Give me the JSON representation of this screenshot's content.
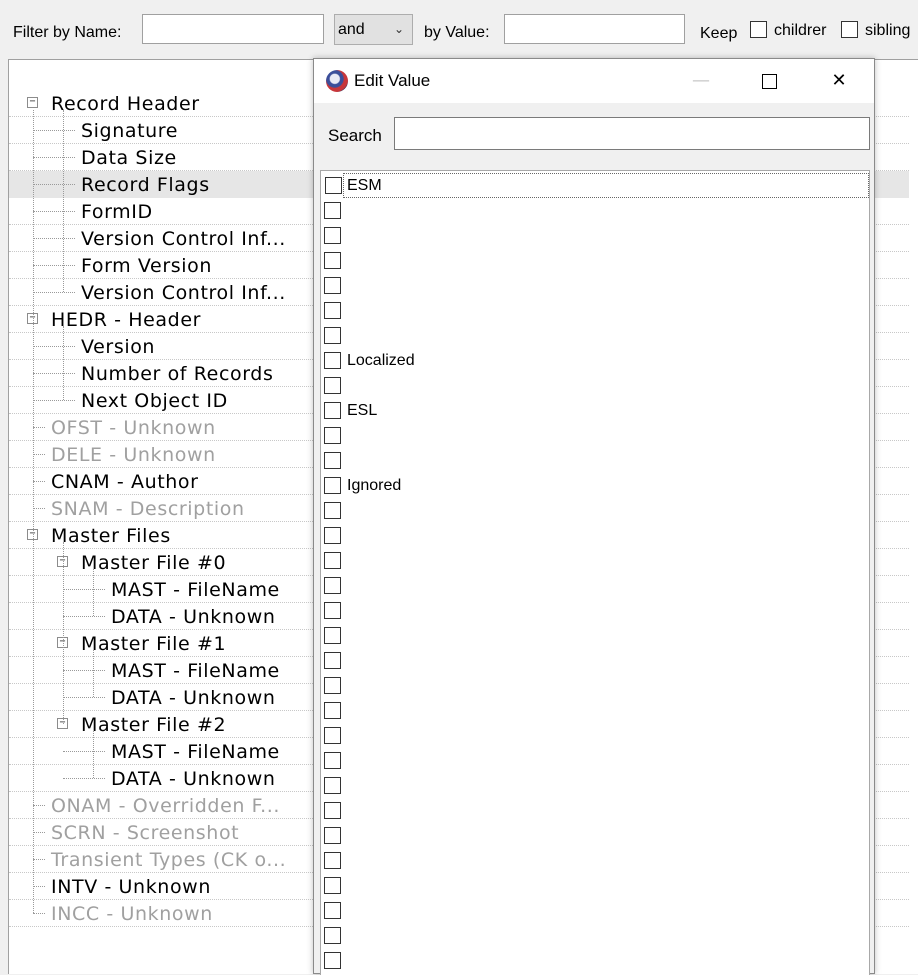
{
  "filter": {
    "name_label": "Filter by Name:",
    "name_value": "",
    "operator": "and",
    "value_label": "by Value:",
    "value_value": "",
    "keep_label": "Keep",
    "children_label": "childrer",
    "siblings_label": "sibling"
  },
  "tree": {
    "rows": [
      {
        "label": "Record Header",
        "level": 0,
        "expander": "−",
        "grey": false
      },
      {
        "label": "Signature",
        "level": 1,
        "grey": false
      },
      {
        "label": "Data Size",
        "level": 1,
        "grey": false
      },
      {
        "label": "Record Flags",
        "level": 1,
        "grey": false,
        "selected": true
      },
      {
        "label": "FormID",
        "level": 1,
        "grey": false
      },
      {
        "label": "Version Control Inf...",
        "level": 1,
        "grey": false
      },
      {
        "label": "Form Version",
        "level": 1,
        "grey": false
      },
      {
        "label": "Version Control Inf...",
        "level": 1,
        "grey": false
      },
      {
        "label": "HEDR - Header",
        "level": 0,
        "expander": "−",
        "grey": false
      },
      {
        "label": "Version",
        "level": 1,
        "grey": false
      },
      {
        "label": "Number of Records",
        "level": 1,
        "grey": false
      },
      {
        "label": "Next Object ID",
        "level": 1,
        "grey": false
      },
      {
        "label": "OFST - Unknown",
        "level": 0,
        "grey": true
      },
      {
        "label": "DELE - Unknown",
        "level": 0,
        "grey": true
      },
      {
        "label": "CNAM - Author",
        "level": 0,
        "grey": false
      },
      {
        "label": "SNAM - Description",
        "level": 0,
        "grey": true
      },
      {
        "label": "Master Files",
        "level": 0,
        "expander": "−",
        "grey": false
      },
      {
        "label": "Master File #0",
        "level": 1,
        "expander": "−",
        "grey": false
      },
      {
        "label": "MAST - FileName",
        "level": 2,
        "grey": false
      },
      {
        "label": "DATA - Unknown",
        "level": 2,
        "grey": false
      },
      {
        "label": "Master File #1",
        "level": 1,
        "expander": "−",
        "grey": false
      },
      {
        "label": "MAST - FileName",
        "level": 2,
        "grey": false
      },
      {
        "label": "DATA - Unknown",
        "level": 2,
        "grey": false
      },
      {
        "label": "Master File #2",
        "level": 1,
        "expander": "−",
        "grey": false
      },
      {
        "label": "MAST - FileName",
        "level": 2,
        "grey": false
      },
      {
        "label": "DATA - Unknown",
        "level": 2,
        "grey": false
      },
      {
        "label": "ONAM - Overridden F...",
        "level": 0,
        "grey": true
      },
      {
        "label": "SCRN - Screenshot",
        "level": 0,
        "grey": true
      },
      {
        "label": "Transient Types (CK o...",
        "level": 0,
        "grey": true
      },
      {
        "label": "INTV - Unknown",
        "level": 0,
        "grey": false
      },
      {
        "label": "INCC - Unknown",
        "level": 0,
        "grey": true
      }
    ]
  },
  "dialog": {
    "title": "Edit Value",
    "icon": "app-globe-icon",
    "minimize_glyph": "—",
    "close_glyph": "✕",
    "search_label": "Search",
    "search_value": "",
    "flags": [
      "ESM",
      "",
      "",
      "",
      "",
      "",
      "",
      "Localized",
      "",
      "ESL",
      "",
      "",
      "Ignored",
      "",
      "",
      "",
      "",
      "",
      "",
      "",
      "",
      "",
      "",
      "",
      "",
      "",
      "",
      "",
      "",
      "",
      "",
      "",
      ""
    ]
  }
}
